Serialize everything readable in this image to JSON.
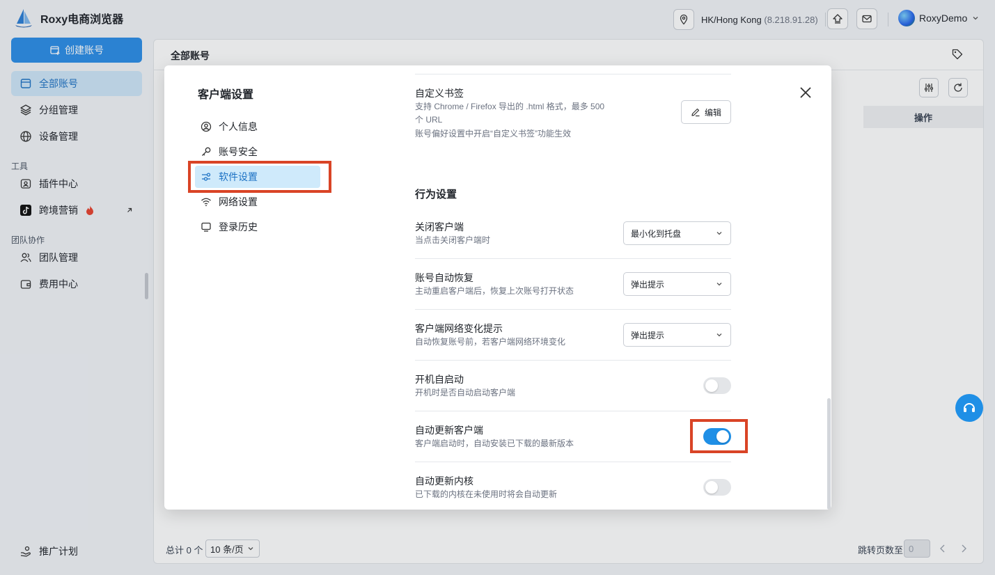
{
  "app": {
    "title": "Roxy电商浏览器"
  },
  "topbar": {
    "location": "HK/Hong Kong",
    "ip": "(8.218.91.28)",
    "user": "RoxyDemo"
  },
  "sidebar": {
    "create_label": "创建账号",
    "items": [
      {
        "label": "全部账号"
      },
      {
        "label": "分组管理"
      },
      {
        "label": "设备管理"
      }
    ],
    "section_tools": "工具",
    "tools": [
      {
        "label": "插件中心"
      },
      {
        "label": "跨境营销"
      }
    ],
    "section_team": "团队协作",
    "team": [
      {
        "label": "团队管理"
      },
      {
        "label": "费用中心"
      }
    ],
    "promo": "推广计划"
  },
  "main": {
    "title": "全部账号",
    "op_header": "操作",
    "total": "总计 0 个",
    "page_size": "10 条/页",
    "jump_label": "跳转页数至",
    "jump_value": "0"
  },
  "modal": {
    "title": "客户端设置",
    "menu": [
      {
        "label": "个人信息"
      },
      {
        "label": "账号安全"
      },
      {
        "label": "软件设置"
      },
      {
        "label": "网络设置"
      },
      {
        "label": "登录历史"
      }
    ],
    "bookmark": {
      "title": "自定义书签",
      "desc1": "支持 Chrome / Firefox 导出的 .html 格式，最多 500",
      "desc2": "个 URL",
      "desc3": "账号偏好设置中开启“自定义书签”功能生效",
      "edit_label": "编辑"
    },
    "behavior_title": "行为设置",
    "rows": [
      {
        "title": "关闭客户端",
        "desc": "当点击关闭客户端时",
        "value": "最小化到托盘"
      },
      {
        "title": "账号自动恢复",
        "desc": "主动重启客户端后，恢复上次账号打开状态",
        "value": "弹出提示"
      },
      {
        "title": "客户端网络变化提示",
        "desc": "自动恢复账号前，若客户端网络环境变化",
        "value": "弹出提示"
      }
    ],
    "toggles": [
      {
        "title": "开机自启动",
        "desc": "开机时是否自动启动客户端",
        "on": false
      },
      {
        "title": "自动更新客户端",
        "desc": "客户端启动时，自动安装已下载的最新版本",
        "on": true
      },
      {
        "title": "自动更新内核",
        "desc": "已下载的内核在未使用时将会自动更新",
        "on": false
      }
    ]
  },
  "colors": {
    "accent": "#1f8fe6",
    "highlight": "#d94426",
    "active_bg": "#cfeafb"
  }
}
